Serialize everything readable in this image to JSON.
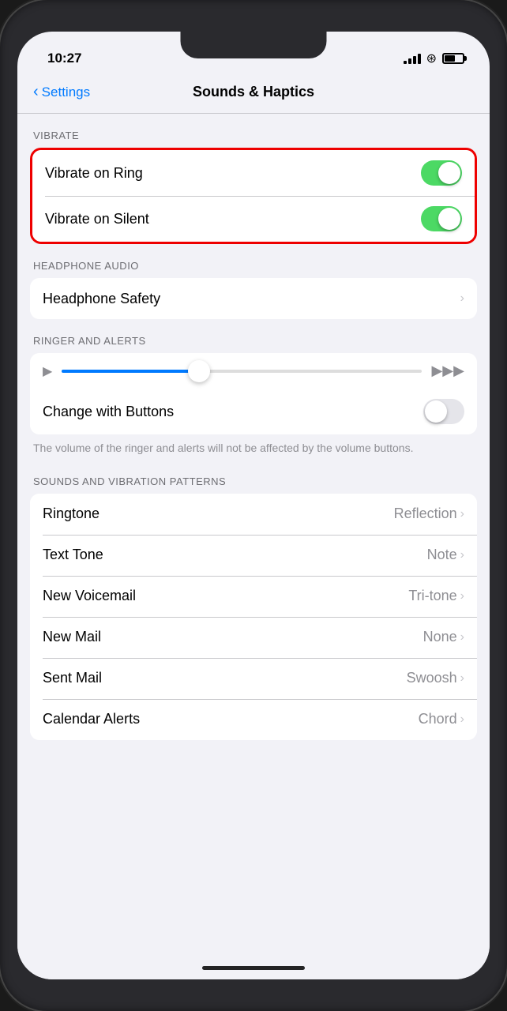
{
  "phone": {
    "time": "10:27"
  },
  "nav": {
    "back_label": "Settings",
    "title": "Sounds & Haptics"
  },
  "sections": {
    "vibrate": {
      "header": "VIBRATE",
      "rows": [
        {
          "label": "Vibrate on Ring",
          "toggle": true,
          "state": "on"
        },
        {
          "label": "Vibrate on Silent",
          "toggle": true,
          "state": "on"
        }
      ]
    },
    "headphone_audio": {
      "header": "HEADPHONE AUDIO",
      "rows": [
        {
          "label": "Headphone Safety",
          "value": "",
          "chevron": true
        }
      ]
    },
    "ringer_alerts": {
      "header": "RINGER AND ALERTS",
      "change_with_buttons_label": "Change with Buttons",
      "description": "The volume of the ringer and alerts will not be affected by the volume buttons."
    },
    "sounds_vibration": {
      "header": "SOUNDS AND VIBRATION PATTERNS",
      "rows": [
        {
          "label": "Ringtone",
          "value": "Reflection",
          "chevron": true
        },
        {
          "label": "Text Tone",
          "value": "Note",
          "chevron": true
        },
        {
          "label": "New Voicemail",
          "value": "Tri-tone",
          "chevron": true
        },
        {
          "label": "New Mail",
          "value": "None",
          "chevron": true
        },
        {
          "label": "Sent Mail",
          "value": "Swoosh",
          "chevron": true
        },
        {
          "label": "Calendar Alerts",
          "value": "Chord",
          "chevron": true
        }
      ]
    }
  }
}
